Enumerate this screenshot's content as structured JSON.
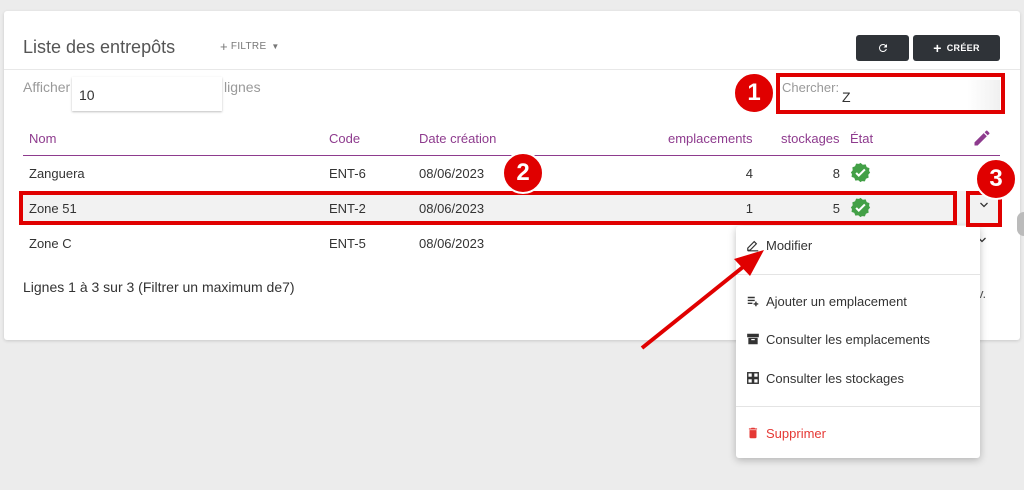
{
  "header": {
    "title": "Liste des entrepôts",
    "filter_label": "FILTRE",
    "create_label": "CRÉER"
  },
  "length_control": {
    "prefix": "Afficher",
    "value": "10",
    "suffix": "lignes"
  },
  "search": {
    "label": "Chercher:",
    "value": "Z"
  },
  "table": {
    "columns": [
      "Nom",
      "Code",
      "Date création",
      "emplacements",
      "stockages",
      "État"
    ],
    "rows": [
      {
        "nom": "Zanguera",
        "code": "ENT-6",
        "date": "08/06/2023",
        "emplacements": "4",
        "stockages": "8"
      },
      {
        "nom": "Zone 51",
        "code": "ENT-2",
        "date": "08/06/2023",
        "emplacements": "1",
        "stockages": "5"
      },
      {
        "nom": "Zone C",
        "code": "ENT-5",
        "date": "08/06/2023",
        "emplacements": "",
        "stockages": ""
      }
    ]
  },
  "footer": {
    "info": "Lignes 1 à 3 sur 3 (Filtrer un maximum de7)",
    "tail": "v."
  },
  "dropdown": {
    "items": [
      {
        "label": "Modifier",
        "icon": "pencil-icon"
      },
      {
        "label": "Ajouter un emplacement",
        "icon": "playlist-add-icon"
      },
      {
        "label": "Consulter les emplacements",
        "icon": "archive-icon"
      },
      {
        "label": "Consulter les stockages",
        "icon": "grid-icon"
      },
      {
        "label": "Supprimer",
        "icon": "trash-icon"
      }
    ]
  },
  "annotations": {
    "badge1": "1",
    "badge2": "2",
    "badge3": "3"
  },
  "colors": {
    "accent": "#8e3b8e",
    "success": "#43a047",
    "danger": "#e53935",
    "highlight": "#e00000",
    "button_bg": "#2f3338"
  }
}
